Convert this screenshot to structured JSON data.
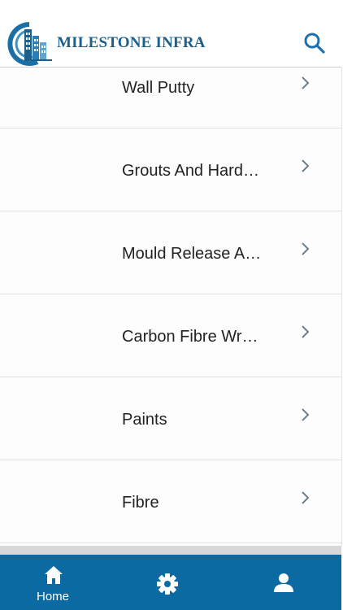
{
  "header": {
    "brand": "MILESTONE INFRA",
    "logo_icon": "building-logo-icon",
    "search_icon": "search-icon",
    "accent_color": "#1c5f8c"
  },
  "categories": [
    {
      "label": "Wall Putty"
    },
    {
      "label": "Grouts And Hard…"
    },
    {
      "label": "Mould Release A…"
    },
    {
      "label": "Carbon Fibre Wr…"
    },
    {
      "label": "Paints"
    },
    {
      "label": "Fibre"
    }
  ],
  "tabbar": {
    "background": "#0c6aa2",
    "tabs": [
      {
        "label": "Home",
        "icon": "home-icon",
        "active": true
      },
      {
        "label": "",
        "icon": "gear-icon",
        "active": false
      },
      {
        "label": "",
        "icon": "user-icon",
        "active": false
      }
    ]
  }
}
